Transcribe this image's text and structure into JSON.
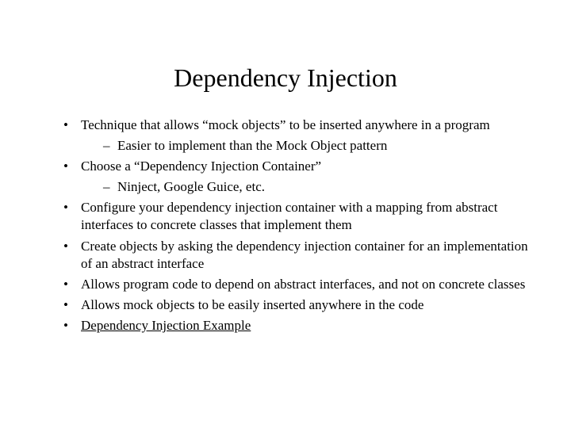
{
  "title": "Dependency Injection",
  "bullets": [
    {
      "text": "Technique that allows “mock objects” to be inserted anywhere in a program",
      "sub": [
        "Easier to implement than the Mock Object pattern"
      ]
    },
    {
      "text": "Choose a “Dependency Injection Container”",
      "sub": [
        "Ninject, Google Guice, etc."
      ]
    },
    {
      "text": "Configure your dependency injection container with a mapping from abstract interfaces to concrete classes that implement them"
    },
    {
      "text": "Create objects by asking the dependency injection container for an implementation of an abstract interface"
    },
    {
      "text": "Allows program code to depend on abstract interfaces, and not on concrete classes"
    },
    {
      "text": "Allows mock objects to be easily inserted anywhere in the code"
    },
    {
      "text": "Dependency Injection Example",
      "link": true
    }
  ]
}
